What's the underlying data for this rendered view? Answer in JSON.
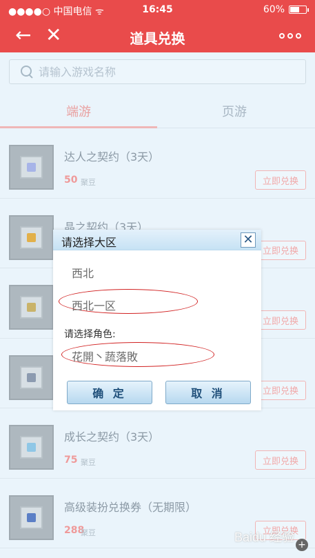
{
  "status": {
    "carrier": "●●●●○ 中国电信 ᯤ",
    "time": "16:45",
    "battery": "60%",
    "battery_level": 0.6
  },
  "nav": {
    "title": "道具兑换",
    "back_icon": "back-arrow-icon",
    "close_icon": "close-icon",
    "more_icon": "more-icon"
  },
  "search": {
    "placeholder": "请输入游戏名称",
    "icon": "search-icon"
  },
  "tabs": [
    {
      "label": "端游",
      "active": true
    },
    {
      "label": "页游",
      "active": false
    }
  ],
  "items": [
    {
      "title": "达人之契约（3天）",
      "price": "50",
      "unit": "聚豆",
      "button": "立即兑换",
      "gem": "#a7b4e8"
    },
    {
      "title": "晶之契约（3天）",
      "price": "",
      "unit": "",
      "button": "立即兑换",
      "gem": "#e2b04a"
    },
    {
      "title": "",
      "price": "",
      "unit": "",
      "button": "立即兑换",
      "gem": "#c9b36a"
    },
    {
      "title": "",
      "price": "",
      "unit": "",
      "button": "立即兑换",
      "gem": "#8c9bb0"
    },
    {
      "title": "成长之契约（3天）",
      "price": "75",
      "unit": "聚豆",
      "button": "立即兑换",
      "gem": "#8fc7e6"
    },
    {
      "title": "高级装扮兑换券（无期限）",
      "price": "288",
      "unit": "聚豆",
      "button": "立即兑换",
      "gem": "#5b7fc6"
    }
  ],
  "dialog": {
    "title": "请选择大区",
    "close_label": "✕",
    "region": "西北",
    "server": "西北一区",
    "role_label": "请选择角色:",
    "role": "花開丶蔬落敗",
    "ok_label": "确 定",
    "cancel_label": "取 消"
  },
  "watermark": "Baidu 经验",
  "colors": {
    "nav_red": "#e94b4b",
    "accent_pink": "#f1a8a8",
    "annotation_red": "#d12020"
  }
}
